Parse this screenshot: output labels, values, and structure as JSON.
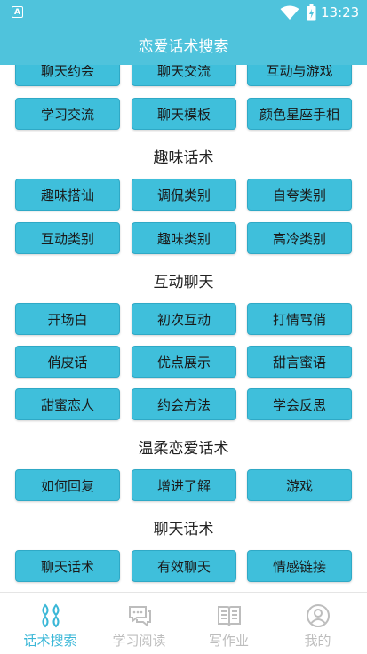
{
  "status_bar": {
    "time": "13:23"
  },
  "header": {
    "title": "恋爱话术搜索"
  },
  "rows": [
    [
      "聊天约会",
      "聊天交流",
      "互动与游戏"
    ],
    [
      "学习交流",
      "聊天模板",
      "颜色星座手相"
    ],
    [
      "趣味搭讪",
      "调侃类别",
      "自夸类别"
    ],
    [
      "互动类别",
      "趣味类别",
      "高冷类别"
    ],
    [
      "开场白",
      "初次互动",
      "打情骂俏"
    ],
    [
      "俏皮话",
      "优点展示",
      "甜言蜜语"
    ],
    [
      "甜蜜恋人",
      "约会方法",
      "学会反思"
    ],
    [
      "如何回复",
      "增进了解",
      "游戏"
    ],
    [
      "聊天话术",
      "有效聊天",
      "情感链接"
    ]
  ],
  "sections": {
    "fun": "趣味话术",
    "interactive": "互动聊天",
    "gentle": "温柔恋爱话术",
    "chat": "聊天话术"
  },
  "tabs": [
    {
      "label": "话术搜索",
      "icon": "grid-icon",
      "active": true
    },
    {
      "label": "学习阅读",
      "icon": "chat-bubble-icon",
      "active": false
    },
    {
      "label": "写作业",
      "icon": "book-icon",
      "active": false
    },
    {
      "label": "我的",
      "icon": "profile-icon",
      "active": false
    }
  ],
  "colors": {
    "primary": "#4fc3dc",
    "button": "#3fbfdb",
    "active_tab": "#3ab7d7",
    "inactive_tab": "#bdbdbd"
  }
}
